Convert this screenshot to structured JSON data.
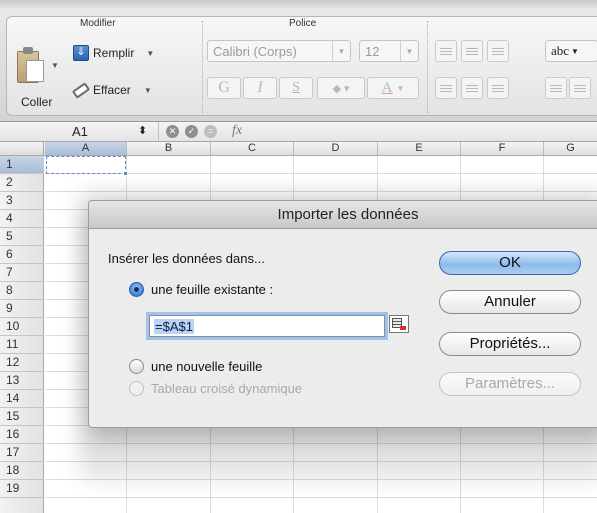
{
  "ribbon": {
    "groups": {
      "modifier": "Modifier",
      "police": "Police"
    },
    "paste_label": "Coller",
    "fill_label": "Remplir",
    "clear_label": "Effacer",
    "font_name": "Calibri (Corps)",
    "font_size": "12",
    "bold_label": "G",
    "italic_label": "I",
    "underline_label": "S",
    "font_color_label": "A",
    "wrap_label": "abc"
  },
  "formula_bar": {
    "cell_ref": "A1",
    "fx_label": "fx"
  },
  "grid": {
    "columns": [
      "A",
      "B",
      "C",
      "D",
      "E",
      "F",
      "G"
    ],
    "rows": [
      "1",
      "2",
      "3",
      "4",
      "5",
      "6",
      "7",
      "8",
      "9",
      "10",
      "11",
      "12",
      "13",
      "14",
      "15",
      "16",
      "17",
      "18",
      "19"
    ]
  },
  "dialog": {
    "title": "Importer les données",
    "insert_label": "Insérer les données dans...",
    "option_existing": "une feuille existante :",
    "reference_value": "=$A$1",
    "option_new": "une nouvelle feuille",
    "option_pivot": "Tableau croisé dynamique",
    "ok": "OK",
    "cancel": "Annuler",
    "properties": "Propriétés...",
    "parameters": "Paramètres..."
  }
}
